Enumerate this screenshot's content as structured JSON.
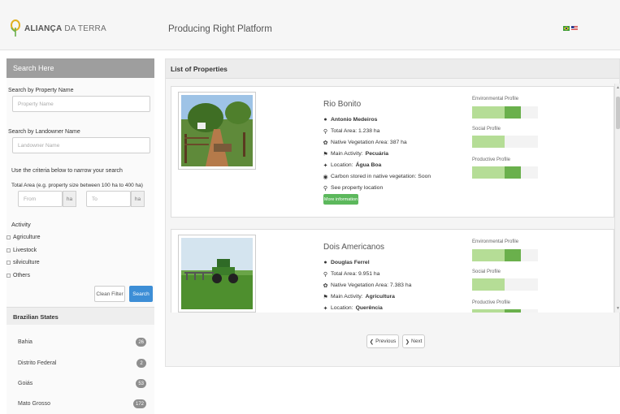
{
  "header": {
    "logo_text_bold": "ALIANÇA",
    "logo_text": "DA TERRA",
    "title": "Producing Right Platform"
  },
  "colors": {
    "accent_green": "#6ab04c",
    "light_green": "#b5dd96",
    "mid_green": "#8ecb6a",
    "button_blue": "#3d8ed6"
  },
  "sidebar": {
    "search_header": "Search Here",
    "property_label": "Search by Property Name",
    "property_placeholder": "Property Name",
    "landowner_label": "Search by Landowner Name",
    "landowner_placeholder": "Landowner Name",
    "criteria_text": "Use the criteria below to narrow your search",
    "area_label": "Total Area (e.g. property size between 100 ha to 400 ha)",
    "from_placeholder": "From",
    "to_placeholder": "To",
    "unit": "ha",
    "activity_label": "Activity",
    "activities": [
      "Agriculture",
      "Livestock",
      "silviculture",
      "Others"
    ],
    "clear_button": "Clean Filter",
    "search_button": "Search",
    "states_header": "Brazilian States",
    "states": [
      {
        "name": "Bahia",
        "count": "26"
      },
      {
        "name": "Distrito Federal",
        "count": "2"
      },
      {
        "name": "Goiás",
        "count": "53"
      },
      {
        "name": "Mato Grosso",
        "count": "172"
      }
    ]
  },
  "main": {
    "header": "List of Properties",
    "previous": "Previous",
    "next": "Next",
    "profile_labels": [
      "Environmental Profile",
      "Social Profile",
      "Productive Profile"
    ],
    "properties": [
      {
        "name": "Rio Bonito",
        "owner": "Antonio Medeiros",
        "total_area": "Total Area: 1.238 ha",
        "native_area": "Native Vegetation Area: 387 ha",
        "activity_prefix": "Main Activity: ",
        "activity": "Pecuária",
        "location_prefix": "Location: ",
        "location": "Água Boa",
        "carbon": "Carbon stored in native vegetation: Soon",
        "see_location": "See property location",
        "more_button": "More information",
        "environmental_level": 3,
        "social_level": 2,
        "productive_level": 3
      },
      {
        "name": "Dois Americanos",
        "owner": "Douglas Ferrel",
        "total_area": "Total Area: 9.951 ha",
        "native_area": "Native Vegetation Area: 7.383 ha",
        "activity_prefix": "Main Activity: ",
        "activity": "Agricultura",
        "location_prefix": "Location: ",
        "location": "Querência",
        "environmental_level": 3,
        "social_level": 2,
        "productive_level": 3
      }
    ]
  }
}
